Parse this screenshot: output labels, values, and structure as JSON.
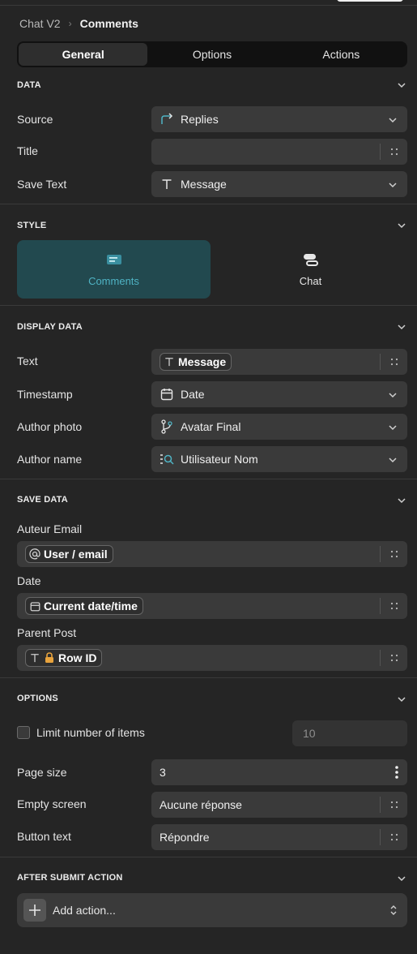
{
  "breadcrumb": {
    "parent": "Chat V2",
    "separator": "›",
    "current": "Comments"
  },
  "tabs": [
    "General",
    "Options",
    "Actions"
  ],
  "active_tab": "General",
  "sections": {
    "data": "DATA",
    "style": "STYLE",
    "display_data": "DISPLAY DATA",
    "save_data": "SAVE DATA",
    "options": "OPTIONS",
    "after_submit": "AFTER SUBMIT ACTION"
  },
  "data": {
    "source": {
      "label": "Source",
      "value": "Replies",
      "icon": "arrow-share-icon"
    },
    "title": {
      "label": "Title",
      "value": ""
    },
    "save_text": {
      "label": "Save Text",
      "value": "Message",
      "icon": "text-type-icon"
    }
  },
  "style": {
    "options": [
      {
        "label": "Comments",
        "icon": "comments-style-icon",
        "selected": true
      },
      {
        "label": "Chat",
        "icon": "chat-style-icon",
        "selected": false
      }
    ]
  },
  "display_data": {
    "text": {
      "label": "Text",
      "value": "Message",
      "icon": "text-type-icon"
    },
    "timestamp": {
      "label": "Timestamp",
      "value": "Date",
      "icon": "calendar-icon"
    },
    "author_photo": {
      "label": "Author photo",
      "value": "Avatar Final",
      "icon": "branch-icon"
    },
    "author_name": {
      "label": "Author name",
      "value": "Utilisateur Nom",
      "icon": "list-search-icon"
    }
  },
  "save_data": {
    "auteur_email": {
      "label": "Auteur Email",
      "value": "User / email",
      "icon": "at-icon"
    },
    "date": {
      "label": "Date",
      "value": "Current date/time",
      "icon": "calendar-icon"
    },
    "parent_post": {
      "label": "Parent Post",
      "value": "Row ID",
      "icon": "lock-icon"
    }
  },
  "options": {
    "limit_items": {
      "label": "Limit number of items",
      "checked": false,
      "placeholder": "10"
    },
    "page_size": {
      "label": "Page size",
      "value": "3"
    },
    "empty_screen": {
      "label": "Empty screen",
      "value": "Aucune réponse"
    },
    "button_text": {
      "label": "Button text",
      "value": "Répondre"
    }
  },
  "after_submit": {
    "add_action": "Add action..."
  },
  "colors": {
    "background": "#252525",
    "field": "#3a3a3a",
    "accent_bg": "#22494f",
    "accent_text": "#4fb3c4",
    "tabs_bg": "#111111"
  }
}
